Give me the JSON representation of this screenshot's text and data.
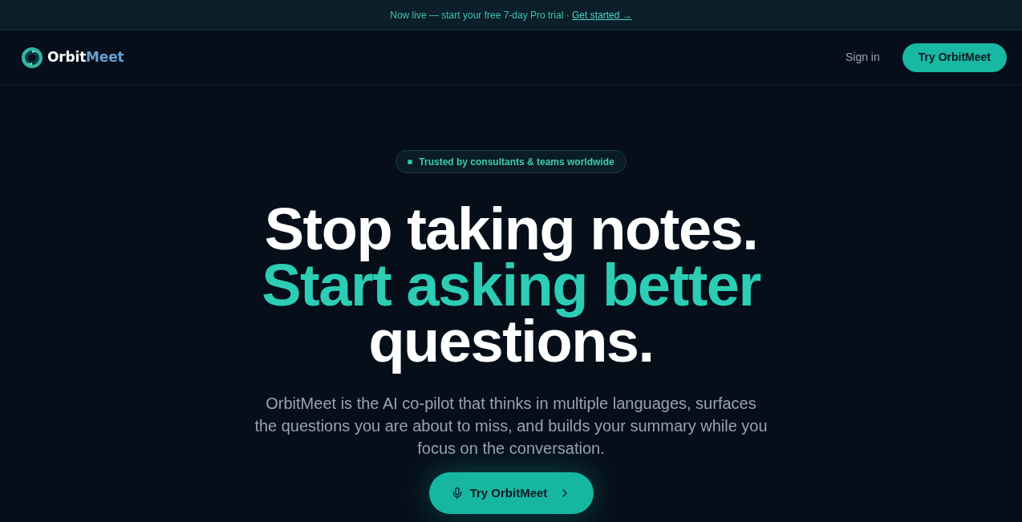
{
  "banner": {
    "text": "Now live — start your free 7-day Pro trial ·",
    "link": "Get started →"
  },
  "header": {
    "logo": {
      "part_1": "Orbit",
      "part_2": "Meet"
    },
    "nav": [
      {
        "label": "Sign in",
        "kind": "link"
      },
      {
        "label": "Try OrbitMeet",
        "kind": "button"
      }
    ]
  },
  "hero": {
    "badge": "Trusted by consultants & teams worldwide",
    "headline": [
      {
        "text": "Stop taking notes.",
        "accent": false
      },
      {
        "text": "Start asking better",
        "accent": true
      },
      {
        "text": "questions.",
        "accent": false
      }
    ],
    "description": "OrbitMeet is the AI co-pilot that thinks in multiple languages, surfaces the questions you are about to miss, and builds your summary while you focus on the conversation.",
    "cta": "Try OrbitMeet"
  }
}
